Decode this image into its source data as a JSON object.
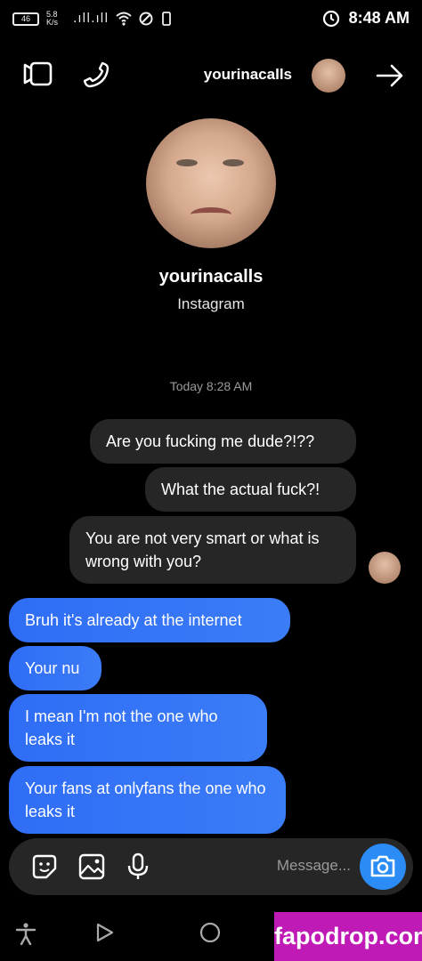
{
  "status_bar": {
    "time": "8:48 AM",
    "battery": "46",
    "network_speed": "5.8 K/s",
    "signal": ".ıll.ıll"
  },
  "header": {
    "username": "yourinacalls"
  },
  "profile": {
    "name": "yourinacalls",
    "subtitle": "Instagram"
  },
  "thread": {
    "timestamp": "Today 8:28 AM",
    "incoming": [
      "Are you fucking me dude?!??",
      "What the actual fuck?!",
      "You are not very smart or what is wrong with you?"
    ],
    "outgoing": [
      "Bruh it's already at the internet",
      "Your nu",
      "I mean I'm not the one who leaks it",
      "Your fans at onlyfans the one who leaks it"
    ]
  },
  "composer": {
    "placeholder": "Message..."
  },
  "watermark": {
    "text": "fapodrop.com"
  },
  "colors": {
    "background": "#000000",
    "incoming_bubble": "#262626",
    "outgoing_bubble": "#3478f6",
    "camera_button": "#2a8cf4",
    "watermark": "#c01ab6"
  }
}
